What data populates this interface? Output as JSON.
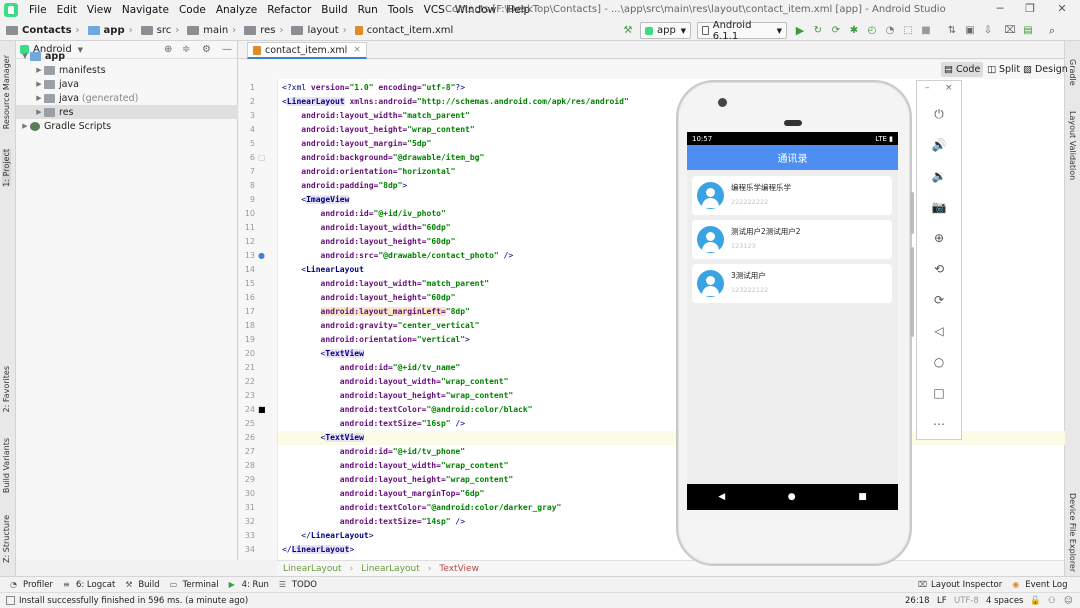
{
  "menu": {
    "items": [
      "File",
      "Edit",
      "View",
      "Navigate",
      "Code",
      "Analyze",
      "Refactor",
      "Build",
      "Run",
      "Tools",
      "VCS",
      "Window",
      "Help"
    ],
    "window_title": "Contacts [F:\\DeskTop\\Contacts] - ...\\app\\src\\main\\res\\layout\\contact_item.xml [app] - Android Studio"
  },
  "breadcrumb_nav": [
    "Contacts",
    "app",
    "src",
    "main",
    "res",
    "layout",
    "contact_item.xml"
  ],
  "toolbar": {
    "run_config": "app",
    "device": "Android 6.1.1"
  },
  "project": {
    "view_selector": "Android",
    "tree": [
      {
        "label": "app",
        "level": 0,
        "expanded": true,
        "icon": "module-folder"
      },
      {
        "label": "manifests",
        "level": 1,
        "expanded": false,
        "icon": "folder"
      },
      {
        "label": "java",
        "level": 1,
        "expanded": false,
        "icon": "folder"
      },
      {
        "label": "java",
        "suffix": "(generated)",
        "level": 1,
        "expanded": false,
        "icon": "folder"
      },
      {
        "label": "res",
        "level": 1,
        "expanded": false,
        "icon": "folder",
        "selected": true
      },
      {
        "label": "Gradle Scripts",
        "level": 0,
        "expanded": false,
        "icon": "gradle"
      }
    ]
  },
  "left_tool_tabs": [
    "Resource Manager",
    "1: Project",
    "2: Favorites",
    "Build Variants",
    "Z: Structure"
  ],
  "right_tool_tabs": [
    "Gradle",
    "Layout Validation",
    "Device File Explorer"
  ],
  "editor": {
    "tab": "contact_item.xml",
    "modes": [
      "Code",
      "Split",
      "Design"
    ],
    "active_mode": "Code",
    "current_line": 26,
    "lines": [
      {
        "n": 1,
        "t": [
          [
            "tag",
            "<?xml "
          ],
          [
            "attr",
            "version="
          ],
          [
            "val",
            "\"1.0\" "
          ],
          [
            "attr",
            "encoding="
          ],
          [
            "val",
            "\"utf-8\""
          ],
          [
            "tag",
            "?>"
          ]
        ]
      },
      {
        "n": 2,
        "t": [
          [
            "tag",
            "<"
          ],
          [
            "taghl",
            "LinearLayout"
          ],
          [
            "tag",
            " "
          ],
          [
            "attr",
            "xmlns:android="
          ],
          [
            "val",
            "\"http://schemas.android.com/apk/res/android\""
          ]
        ]
      },
      {
        "n": 3,
        "t": [
          [
            "tag",
            "    "
          ],
          [
            "attr",
            "android:layout_width="
          ],
          [
            "val",
            "\"match_parent\""
          ]
        ]
      },
      {
        "n": 4,
        "t": [
          [
            "tag",
            "    "
          ],
          [
            "attr",
            "android:layout_height="
          ],
          [
            "val",
            "\"wrap_content\""
          ]
        ]
      },
      {
        "n": 5,
        "t": [
          [
            "tag",
            "    "
          ],
          [
            "attr",
            "android:layout_margin="
          ],
          [
            "val",
            "\"5dp\""
          ]
        ]
      },
      {
        "n": 6,
        "t": [
          [
            "tag",
            "    "
          ],
          [
            "attr",
            "android:background="
          ],
          [
            "val",
            "\"@drawable/item_bg\""
          ]
        ]
      },
      {
        "n": 7,
        "t": [
          [
            "tag",
            "    "
          ],
          [
            "attr",
            "android:orientation="
          ],
          [
            "val",
            "\"horizontal\""
          ]
        ]
      },
      {
        "n": 8,
        "t": [
          [
            "tag",
            "    "
          ],
          [
            "attr",
            "android:padding="
          ],
          [
            "val",
            "\"8dp\""
          ],
          [
            "tag",
            ">"
          ]
        ]
      },
      {
        "n": 9,
        "t": [
          [
            "tag",
            "    <"
          ],
          [
            "taghl",
            "ImageView"
          ]
        ]
      },
      {
        "n": 10,
        "t": [
          [
            "tag",
            "        "
          ],
          [
            "attr",
            "android:id="
          ],
          [
            "val",
            "\"@+id/iv_photo\""
          ]
        ]
      },
      {
        "n": 11,
        "t": [
          [
            "tag",
            "        "
          ],
          [
            "attr",
            "android:layout_width="
          ],
          [
            "val",
            "\"60dp\""
          ]
        ]
      },
      {
        "n": 12,
        "t": [
          [
            "tag",
            "        "
          ],
          [
            "attr",
            "android:layout_height="
          ],
          [
            "val",
            "\"60dp\""
          ]
        ]
      },
      {
        "n": 13,
        "t": [
          [
            "tag",
            "        "
          ],
          [
            "attr",
            "android:src="
          ],
          [
            "val",
            "\"@drawable/contact_photo\" "
          ],
          [
            "tag",
            "/>"
          ]
        ]
      },
      {
        "n": 14,
        "t": [
          [
            "tag",
            "    <"
          ],
          [
            "tagname",
            "LinearLayout"
          ]
        ]
      },
      {
        "n": 15,
        "t": [
          [
            "tag",
            "        "
          ],
          [
            "attr",
            "android:layout_width="
          ],
          [
            "val",
            "\"match_parent\""
          ]
        ]
      },
      {
        "n": 16,
        "t": [
          [
            "tag",
            "        "
          ],
          [
            "attr",
            "android:layout_height="
          ],
          [
            "val",
            "\"60dp\""
          ]
        ]
      },
      {
        "n": 17,
        "t": [
          [
            "tag",
            "        "
          ],
          [
            "attrhl",
            "android:layout_marginLeft="
          ],
          [
            "val",
            "\"8dp\""
          ]
        ]
      },
      {
        "n": 18,
        "t": [
          [
            "tag",
            "        "
          ],
          [
            "attr",
            "android:gravity="
          ],
          [
            "val",
            "\"center_vertical\""
          ]
        ]
      },
      {
        "n": 19,
        "t": [
          [
            "tag",
            "        "
          ],
          [
            "attr",
            "android:orientation="
          ],
          [
            "val",
            "\"vertical\""
          ],
          [
            "tag",
            ">"
          ]
        ]
      },
      {
        "n": 20,
        "t": [
          [
            "tag",
            "        <"
          ],
          [
            "taghl",
            "TextView"
          ]
        ]
      },
      {
        "n": 21,
        "t": [
          [
            "tag",
            "            "
          ],
          [
            "attr",
            "android:id="
          ],
          [
            "val",
            "\"@+id/tv_name\""
          ]
        ]
      },
      {
        "n": 22,
        "t": [
          [
            "tag",
            "            "
          ],
          [
            "attr",
            "android:layout_width="
          ],
          [
            "val",
            "\"wrap_content\""
          ]
        ]
      },
      {
        "n": 23,
        "t": [
          [
            "tag",
            "            "
          ],
          [
            "attr",
            "android:layout_height="
          ],
          [
            "val",
            "\"wrap_content\""
          ]
        ]
      },
      {
        "n": 24,
        "t": [
          [
            "tag",
            "            "
          ],
          [
            "attr",
            "android:textColor="
          ],
          [
            "val",
            "\"@android:color/black\""
          ]
        ]
      },
      {
        "n": 25,
        "t": [
          [
            "tag",
            "            "
          ],
          [
            "attr",
            "android:textSize="
          ],
          [
            "val",
            "\"16sp\" "
          ],
          [
            "tag",
            "/>"
          ]
        ]
      },
      {
        "n": 26,
        "t": [
          [
            "tag",
            "        <"
          ],
          [
            "taghl",
            "TextView"
          ]
        ]
      },
      {
        "n": 27,
        "t": [
          [
            "tag",
            "            "
          ],
          [
            "attr",
            "android:id="
          ],
          [
            "val",
            "\"@+id/tv_phone\""
          ]
        ]
      },
      {
        "n": 28,
        "t": [
          [
            "tag",
            "            "
          ],
          [
            "attr",
            "android:layout_width="
          ],
          [
            "val",
            "\"wrap_content\""
          ]
        ]
      },
      {
        "n": 29,
        "t": [
          [
            "tag",
            "            "
          ],
          [
            "attr",
            "android:layout_height="
          ],
          [
            "val",
            "\"wrap_content\""
          ]
        ]
      },
      {
        "n": 30,
        "t": [
          [
            "tag",
            "            "
          ],
          [
            "attr",
            "android:layout_marginTop="
          ],
          [
            "val",
            "\"6dp\""
          ]
        ]
      },
      {
        "n": 31,
        "t": [
          [
            "tag",
            "            "
          ],
          [
            "attr",
            "android:textColor="
          ],
          [
            "val",
            "\"@android:color/darker_gray\""
          ]
        ]
      },
      {
        "n": 32,
        "t": [
          [
            "tag",
            "            "
          ],
          [
            "attr",
            "android:textSize="
          ],
          [
            "val",
            "\"14sp\" "
          ],
          [
            "tag",
            "/>"
          ]
        ]
      },
      {
        "n": 33,
        "t": [
          [
            "tag",
            "    </"
          ],
          [
            "tagname",
            "LinearLayout"
          ],
          [
            "tag",
            ">"
          ]
        ]
      },
      {
        "n": 34,
        "t": [
          [
            "tag",
            "</"
          ],
          [
            "taghl",
            "LinearLayout"
          ],
          [
            "tag",
            ">"
          ]
        ]
      }
    ],
    "breadcrumbs": [
      "LinearLayout",
      "LinearLayout",
      "TextView"
    ]
  },
  "emulator": {
    "status_time": "10:57",
    "status_right": "LTE",
    "app_title": "通讯录",
    "contacts": [
      {
        "name": "编程乐学编程乐学",
        "phone": "222222222"
      },
      {
        "name": "测试用户2测试用户2",
        "phone": "123123"
      },
      {
        "name": "3测试用户",
        "phone": "123222122"
      }
    ],
    "nav": [
      "◀",
      "●",
      "■"
    ],
    "toolbar_icons": [
      "power-icon",
      "volume-up-icon",
      "volume-down-icon",
      "camera-icon",
      "zoom-in-icon",
      "rotate-left-icon",
      "rotate-right-icon",
      "back-icon",
      "home-icon",
      "overview-icon",
      "more-icon"
    ]
  },
  "bottom_tabs": [
    {
      "label": "Profiler",
      "icon": "profiler-icon"
    },
    {
      "label": "6: Logcat",
      "icon": "logcat-icon"
    },
    {
      "label": "Build",
      "icon": "build-icon"
    },
    {
      "label": "Terminal",
      "icon": "terminal-icon"
    },
    {
      "label": "4: Run",
      "icon": "run-icon"
    },
    {
      "label": "TODO",
      "icon": "todo-icon"
    }
  ],
  "bottom_right_tabs": [
    {
      "label": "Layout Inspector",
      "icon": "layout-inspector-icon"
    },
    {
      "label": "Event Log",
      "icon": "event-log-icon"
    }
  ],
  "status": {
    "message": "Install successfully finished in 596 ms. (a minute ago)",
    "position": "26:18",
    "line_sep": "LF",
    "encoding": "UTF-8",
    "indent": "4 spaces"
  },
  "colors": {
    "accent": "#4083c9",
    "app_bar": "#4e8ef0",
    "avatar": "#3aa3e3",
    "run_green": "#3c9b3c"
  }
}
